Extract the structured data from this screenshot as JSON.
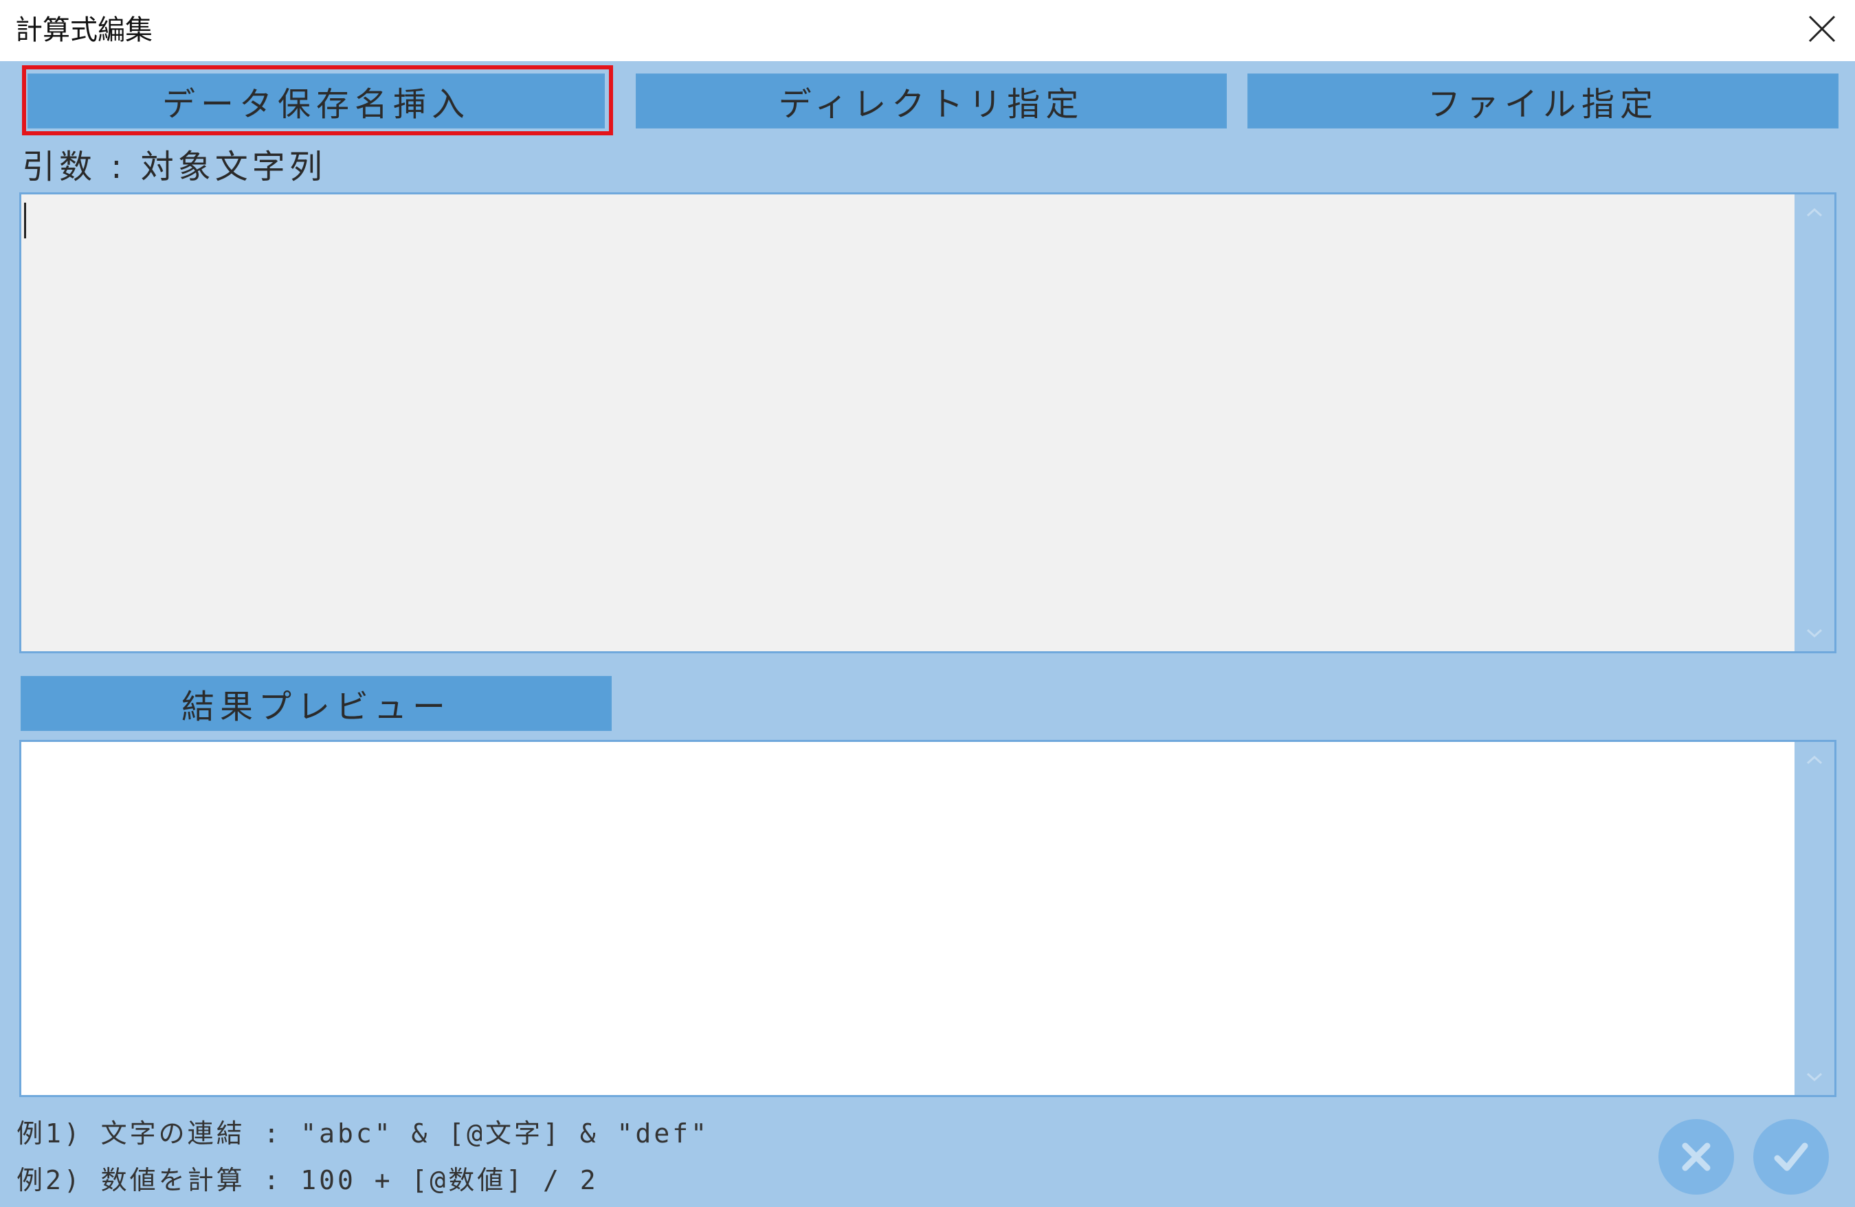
{
  "window": {
    "title": "計算式編集"
  },
  "toolbar": {
    "insert_data_name_label": "データ保存名挿入",
    "directory_label": "ディレクトリ指定",
    "file_label": "ファイル指定"
  },
  "argument": {
    "label": "引数 : 対象文字列",
    "value": ""
  },
  "preview": {
    "button_label": "結果プレビュー",
    "value": ""
  },
  "examples": [
    "例1) 文字の連結 : \"abc\" & [@文字] & \"def\"",
    "例2) 数値を計算 : 100 + [@数値] / 2"
  ],
  "icons": {
    "close": "close-icon",
    "cancel": "cancel-icon",
    "confirm": "check-icon",
    "scroll_up": "chevron-up-icon",
    "scroll_down": "chevron-down-icon"
  },
  "colors": {
    "client_bg": "#a3c8e9",
    "button_bg": "#589fd8",
    "highlight": "#e3141b",
    "input_bg": "#f1f1f1",
    "preview_bg": "#ffffff"
  }
}
